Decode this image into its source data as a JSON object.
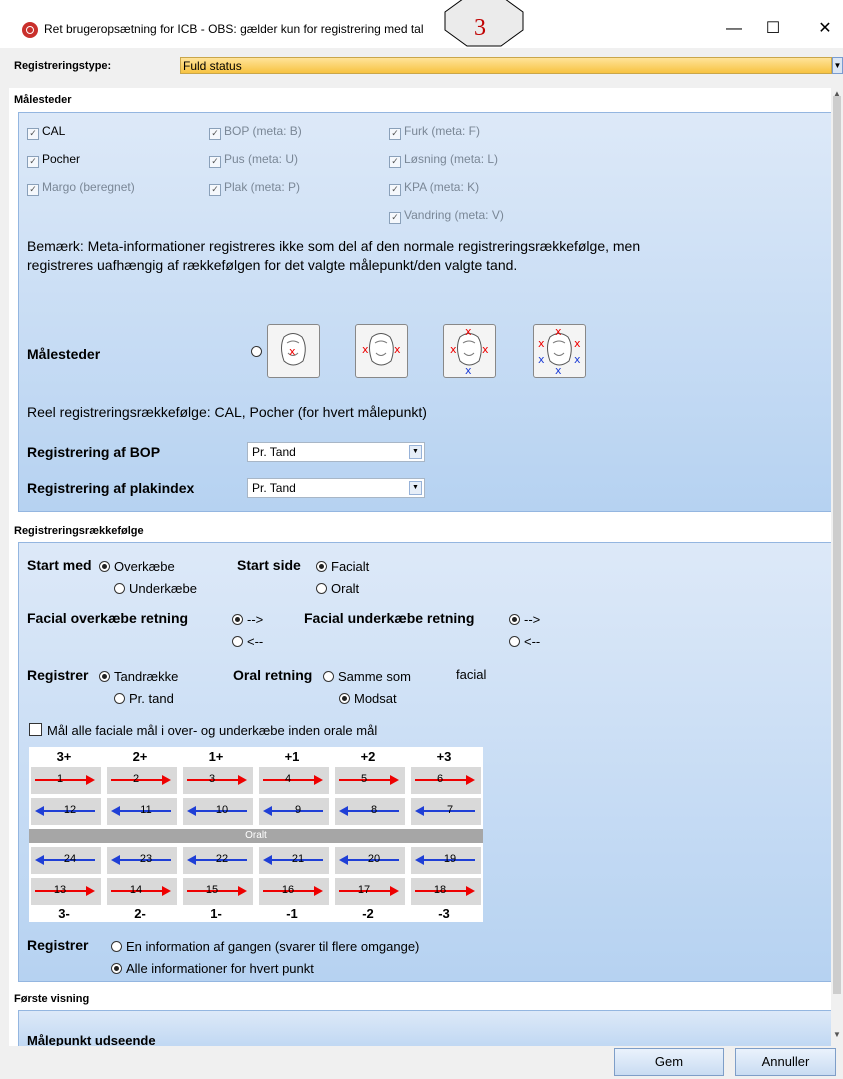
{
  "window": {
    "title": "Ret brugeropsætning for ICB - OBS: gælder kun for registrering med tal",
    "badge": "3",
    "minimize": "—",
    "maximize": "☐",
    "close": "✕"
  },
  "regtype": {
    "label": "Registreringstype:",
    "value": "Fuld status"
  },
  "malesteder": {
    "section_title": "Målesteder",
    "checkboxes": {
      "cal": "CAL",
      "pocher": "Pocher",
      "margo": "Margo (beregnet)",
      "bop": "BOP (meta: B)",
      "pus": "Pus (meta: U)",
      "plak": "Plak (meta: P)",
      "furk": "Furk (meta: F)",
      "losning": "Løsning (meta: L)",
      "kpa": "KPA (meta: K)",
      "vandring": "Vandring (meta: V)"
    },
    "note_line1": "Bemærk: Meta-informationer registreres ikke som del af den normale registreringsrækkefølge, men",
    "note_line2": "registreres uafhængig af rækkefølgen for det valgte målepunkt/den valgte tand.",
    "malesteder_label": "Målesteder",
    "selected_option": 3,
    "reel": "Reel registreringsrækkefølge: CAL, Pocher (for hvert målepunkt)",
    "bop_label": "Registrering af BOP",
    "bop_value": "Pr. Tand",
    "plak_label": "Registrering af plakindex",
    "plak_value": "Pr. Tand"
  },
  "raekkefolge": {
    "section_title": "Registreringsrækkefølge",
    "start_med_label": "Start med",
    "start_med_opt1": "Overkæbe",
    "start_med_opt2": "Underkæbe",
    "start_side_label": "Start side",
    "start_side_opt1": "Facialt",
    "start_side_opt2": "Oralt",
    "facial_over_label": "Facial overkæbe retning",
    "facial_under_label": "Facial underkæbe retning",
    "dir_fwd": "-->",
    "dir_back": "<--",
    "registrer_label": "Registrer",
    "registrer_opt1": "Tandrække",
    "registrer_opt2": "Pr. tand",
    "oral_retning_label": "Oral retning",
    "oral_opt1": "Samme som",
    "oral_opt1_suffix": "facial",
    "oral_opt2": "Modsat",
    "mal_alle": "Mål alle faciale mål i over- og underkæbe inden orale mål",
    "grid_top_headers": [
      "3+",
      "2+",
      "1+",
      "+1",
      "+2",
      "+3"
    ],
    "grid_row1": [
      "1",
      "2",
      "3",
      "4",
      "5",
      "6"
    ],
    "grid_row2": [
      "12",
      "11",
      "10",
      "9",
      "8",
      "7"
    ],
    "oralt": "Oralt",
    "grid_row3": [
      "24",
      "23",
      "22",
      "21",
      "20",
      "19"
    ],
    "grid_row4": [
      "13",
      "14",
      "15",
      "16",
      "17",
      "18"
    ],
    "grid_bottom_headers": [
      "3-",
      "2-",
      "1-",
      "-1",
      "-2",
      "-3"
    ],
    "registrer2_label": "Registrer",
    "reg2_opt1": "En information af gangen (svarer til flere omgange)",
    "reg2_opt2": "Alle informationer for hvert punkt"
  },
  "forste": {
    "section_title": "Første visning",
    "partial_label": "Målepunkt udseende"
  },
  "footer": {
    "save": "Gem",
    "cancel": "Annuller"
  }
}
